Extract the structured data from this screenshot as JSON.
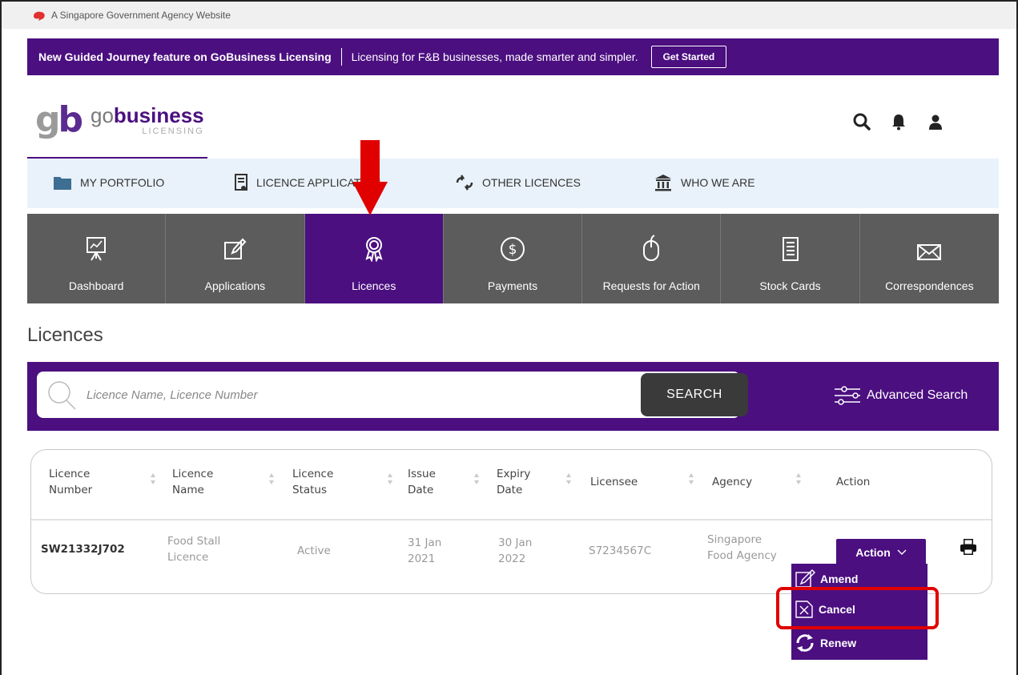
{
  "gov_banner": {
    "text": "A Singapore Government Agency Website"
  },
  "announcement": {
    "title": "New Guided Journey feature on GoBusiness Licensing",
    "message": "Licensing for F&B businesses, made smarter and simpler.",
    "button": "Get Started"
  },
  "logo": {
    "brand_prefix": "go",
    "brand_bold": "business",
    "sub": "LICENSING"
  },
  "header_icons": [
    "search-icon",
    "bell-icon",
    "user-icon"
  ],
  "topnav": [
    {
      "label": "MY PORTFOLIO",
      "icon": "folder-icon"
    },
    {
      "label": "LICENCE APPLICATION",
      "icon": "document-icon"
    },
    {
      "label": "OTHER LICENCES",
      "icon": "transfer-icon"
    },
    {
      "label": "WHO WE ARE",
      "icon": "building-icon"
    }
  ],
  "tiles": [
    {
      "label": "Dashboard",
      "icon": "presentation-icon"
    },
    {
      "label": "Applications",
      "icon": "edit-icon"
    },
    {
      "label": "Licences",
      "icon": "award-icon",
      "active": true
    },
    {
      "label": "Payments",
      "icon": "dollar-icon"
    },
    {
      "label": "Requests for Action",
      "icon": "mouse-icon"
    },
    {
      "label": "Stock Cards",
      "icon": "clipboard-icon"
    },
    {
      "label": "Correspondences",
      "icon": "envelope-icon"
    }
  ],
  "page_title": "Licences",
  "search": {
    "placeholder": "Licence Name, Licence Number",
    "button": "SEARCH",
    "advanced": "Advanced Search"
  },
  "table": {
    "headers": {
      "licence_number": [
        "Licence",
        "Number"
      ],
      "licence_name": [
        "Licence",
        "Name"
      ],
      "licence_status": [
        "Licence",
        "Status"
      ],
      "issue_date": [
        "Issue",
        "Date"
      ],
      "expiry_date": [
        "Expiry",
        "Date"
      ],
      "licensee": "Licensee",
      "agency": "Agency",
      "action": "Action"
    },
    "rows": [
      {
        "licence_number": "SW21332J702",
        "licence_name": [
          "Food Stall",
          "Licence"
        ],
        "status": "Active",
        "issue_date": [
          "31 Jan",
          "2021"
        ],
        "expiry_date": [
          "30 Jan",
          "2022"
        ],
        "licensee": "S7234567C",
        "agency": [
          "Singapore",
          "Food Agency"
        ]
      }
    ]
  },
  "action_menu": {
    "button": "Action",
    "items": [
      {
        "label": "Amend",
        "icon": "pencil-icon"
      },
      {
        "label": "Cancel",
        "icon": "cancel-doc-icon"
      },
      {
        "label": "Renew",
        "icon": "refresh-icon"
      }
    ]
  },
  "colors": {
    "primary": "#4b0f80",
    "tile_bg": "#5c5c5c",
    "nav_bg": "#e9f2fa",
    "highlight": "#e00000"
  }
}
